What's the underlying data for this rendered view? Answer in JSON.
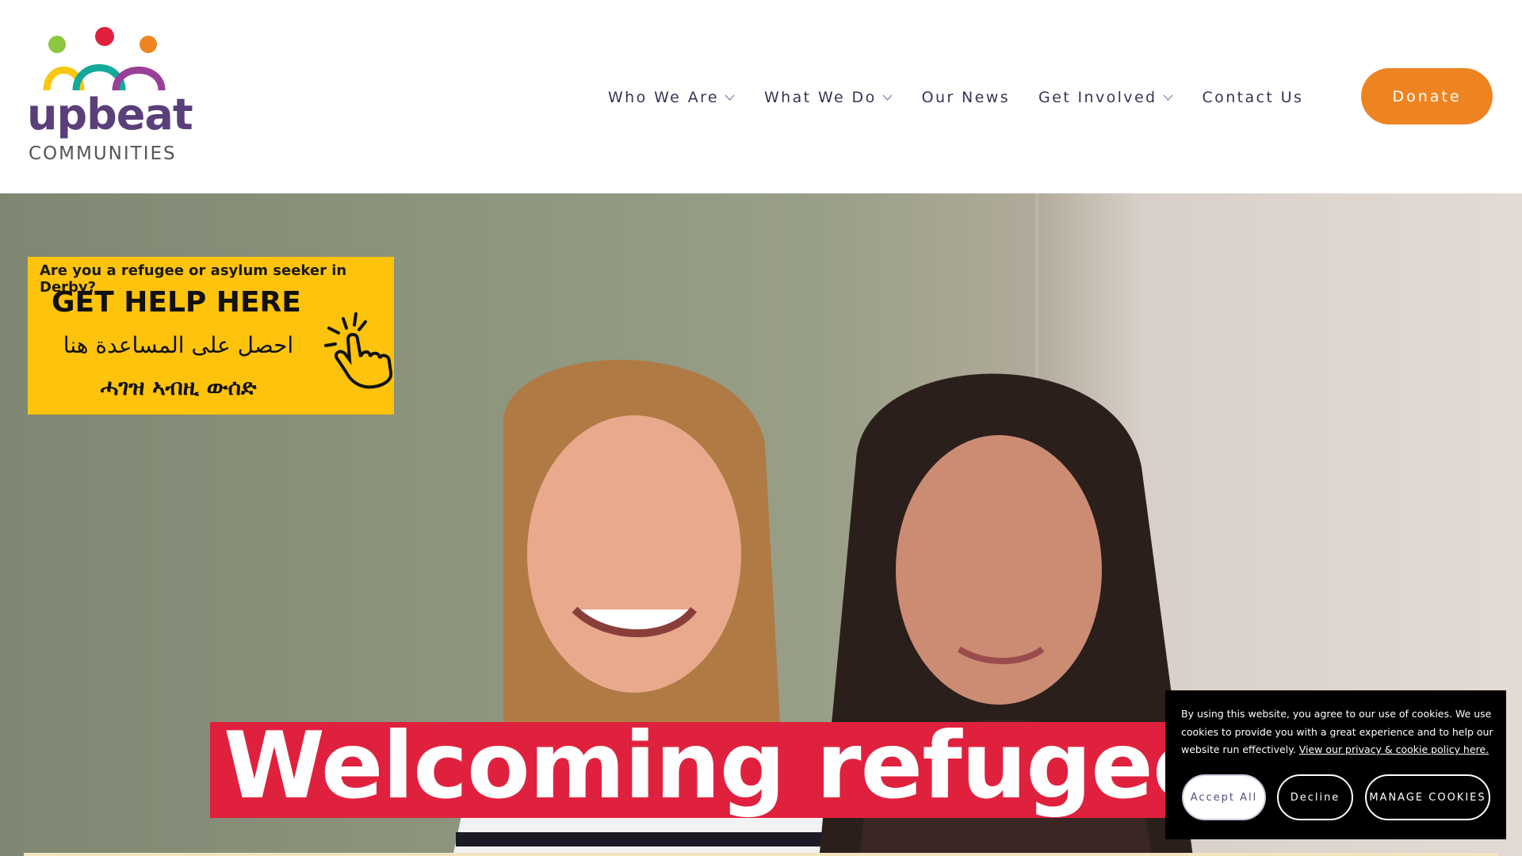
{
  "header": {
    "logo": {
      "wordmark": "upbeat",
      "subword": "COMMUNITIES"
    },
    "nav": [
      {
        "label": "Who We Are",
        "has_dropdown": true
      },
      {
        "label": "What We Do",
        "has_dropdown": true
      },
      {
        "label": "Our News",
        "has_dropdown": false
      },
      {
        "label": "Get Involved",
        "has_dropdown": true
      },
      {
        "label": "Contact Us",
        "has_dropdown": false
      }
    ],
    "donate_label": "Donate"
  },
  "hero": {
    "help_banner": {
      "question": "Are you a refugee or asylum seeker in Derby?",
      "heading": "GET HELP HERE",
      "arabic": "احصل على المساعدة هنا",
      "tigrinya": "ሓገዝ ኣብዚ ውሰድ"
    },
    "headline": "Welcoming refugee"
  },
  "cookie": {
    "message": "By using this website, you agree to our use of cookies. We use cookies to provide you with a great experience and to help our website run effectively.",
    "policy_link": "View our privacy & cookie policy here.",
    "accept_label": "Accept All",
    "decline_label": "Decline",
    "manage_label": "MANAGE COOKIES"
  },
  "colors": {
    "brand_purple": "#5a3f7a",
    "donate_orange": "#ee8421",
    "banner_yellow": "#fec30c",
    "headline_red": "#e0213e"
  }
}
